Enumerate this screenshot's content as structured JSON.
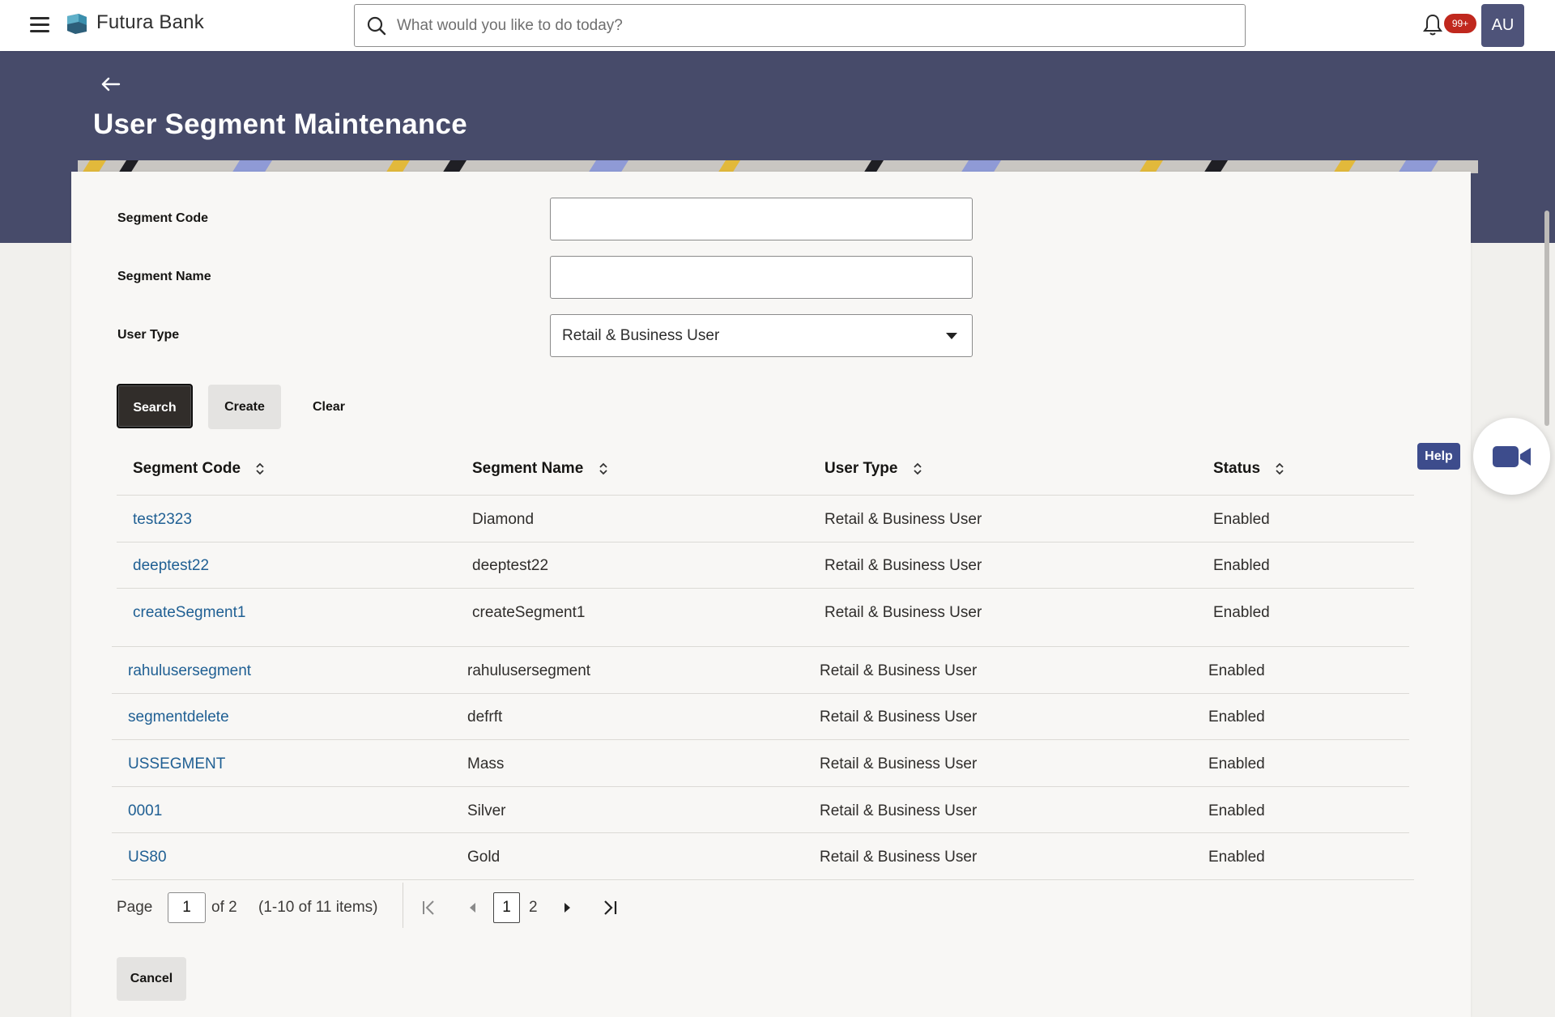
{
  "topbar": {
    "brand": "Futura Bank",
    "search_placeholder": "What would you like to do today?",
    "notification_count": "99+",
    "avatar_initials": "AU"
  },
  "page": {
    "title": "User Segment Maintenance"
  },
  "form": {
    "segment_code_label": "Segment Code",
    "segment_code_value": "",
    "segment_name_label": "Segment Name",
    "segment_name_value": "",
    "user_type_label": "User Type",
    "user_type_value": "Retail & Business User"
  },
  "buttons": {
    "search": "Search",
    "create": "Create",
    "clear": "Clear",
    "cancel": "Cancel",
    "help": "Help"
  },
  "table": {
    "headers": [
      "Segment Code",
      "Segment Name",
      "User Type",
      "Status"
    ],
    "rows": [
      {
        "code": "test2323",
        "name": "Diamond",
        "type": "Retail & Business User",
        "status": "Enabled"
      },
      {
        "code": "deeptest22",
        "name": "deeptest22",
        "type": "Retail & Business User",
        "status": "Enabled"
      },
      {
        "code": "createSegment1",
        "name": "createSegment1",
        "type": "Retail & Business User",
        "status": "Enabled"
      },
      {
        "code": "rahulusersegment",
        "name": "rahulusersegment",
        "type": "Retail & Business User",
        "status": "Enabled"
      },
      {
        "code": "segmentdelete",
        "name": "defrft",
        "type": "Retail & Business User",
        "status": "Enabled"
      },
      {
        "code": "USSEGMENT",
        "name": "Mass",
        "type": "Retail & Business User",
        "status": "Enabled"
      },
      {
        "code": "0001",
        "name": "Silver",
        "type": "Retail & Business User",
        "status": "Enabled"
      },
      {
        "code": "US80",
        "name": "Gold",
        "type": "Retail & Business User",
        "status": "Enabled"
      }
    ]
  },
  "pagination": {
    "page_label": "Page",
    "page_value": "1",
    "of_label": "of 2",
    "items_label": "(1-10 of 11 items)",
    "current_page": "1",
    "next_page": "2"
  },
  "colors": {
    "header_band": "#474b6a",
    "primary_button": "#312d2a",
    "link": "#1f5f93",
    "badge": "#c0281e",
    "help": "#3d4c8c"
  }
}
